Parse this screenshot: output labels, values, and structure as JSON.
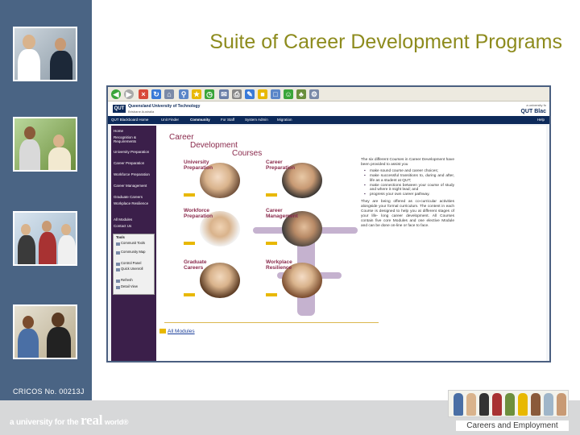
{
  "slide": {
    "title": "Suite of Career Development Programs",
    "cricos": "CRICOS No. 00213J",
    "tagline_prefix": "a university for the",
    "tagline_real": "real",
    "tagline_world": "world",
    "tagline_mark": "®",
    "footer_label": "Careers and Employment"
  },
  "colors": {
    "left_bar": "#4a6484",
    "title": "#8d8b1d",
    "bottom_bar": "#d7d8d9",
    "qut_navy": "#0d2a5a",
    "left_nav_purple": "#3b1f4a",
    "module_title": "#8a2a4c",
    "accent_yellow": "#e8b800"
  },
  "browser": {
    "toolbar_icons": [
      "back-icon",
      "forward-icon",
      "stop-icon",
      "refresh-icon",
      "home-icon",
      "search-icon",
      "favorites-icon",
      "history-icon",
      "mail-icon",
      "print-icon",
      "edit-icon",
      "folder-icon",
      "discuss-icon",
      "messenger-icon",
      "research-icon",
      "tools-icon"
    ],
    "header": {
      "institution": "Queensland University of Technology",
      "location": "Brisbane Australia",
      "logo_text": "QUT",
      "right_small": "a university fo",
      "right_title": "QUT Blac"
    },
    "nav": {
      "items": [
        "QUT Blackboard Home",
        "Unit Finder",
        "Community",
        "For Staff",
        "System Admin",
        "Migration"
      ],
      "right": "Help"
    },
    "left_nav": {
      "items": [
        "Home",
        "Recognition & Requirements",
        "University Preparation",
        "Career Preparation",
        "Workforce Preparation",
        "Career Management",
        "Graduate Careers",
        "Workplace Resilience",
        "All Modules",
        "Contact Us"
      ],
      "tools_title": "Tools",
      "tools_items": [
        "Communit Tools",
        "Community Map",
        "Control Panel",
        "Quick Unenroll",
        "Refresh",
        "Detail View"
      ]
    },
    "content": {
      "heading_line1": "Career",
      "heading_line2": "Development",
      "heading_line3": "Courses",
      "courses": [
        {
          "label": "University Preparation"
        },
        {
          "label": "Career Preparation"
        },
        {
          "label": "Workforce Preparation"
        },
        {
          "label": "Career Management"
        },
        {
          "label": "Graduate Careers"
        },
        {
          "label": "Workplace Resilience"
        }
      ],
      "intro": "The six different Courses in Career Development have been provided to assist you",
      "bullets": [
        "make sound course and career choices;",
        "make successful transitions to, during and after, life as a student at QUT;",
        "make connections between your course of study and where it might lead; and",
        "progress your own career pathway."
      ],
      "paragraph": "They are being offered as co-curricular activities alongside your formal curriculum. The content in each Course is designed to help you at different stages of your life- long career development. All Courses contain five core Modules and one elective Module and can be done on-line or face to face.",
      "all_modules": "All Modules"
    }
  }
}
